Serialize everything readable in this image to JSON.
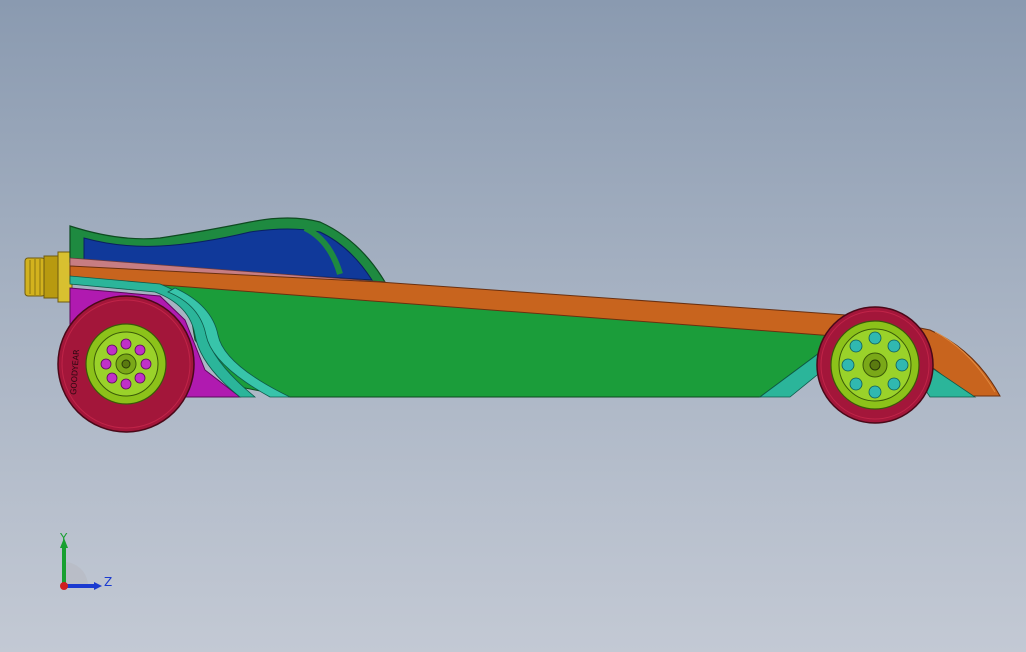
{
  "viewport": {
    "background_top": "#8a9ab0",
    "background_bottom": "#c3c9d4"
  },
  "model": {
    "colors": {
      "body_green": "#1b9d3a",
      "canopy_blue": "#10399a",
      "canopy_frame": "#1e8a40",
      "rail_orange": "#c8641e",
      "stripe_pink": "#c77d82",
      "rear_magenta": "#b01ab0",
      "fillet_teal": "#2bb59a",
      "tire_crimson": "#a3163a",
      "rim_lime": "#8cc21a",
      "hole_purple": "#c030c8",
      "hole_cyan": "#30b8b0",
      "nozzle_gold": "#d2b21e"
    },
    "rear_tire_text": "GOODYEAR"
  },
  "triad": {
    "y_label": "Y",
    "z_label": "Z",
    "y_color": "#18a030",
    "z_color": "#1a3ad0",
    "x_color": "#d02020"
  }
}
